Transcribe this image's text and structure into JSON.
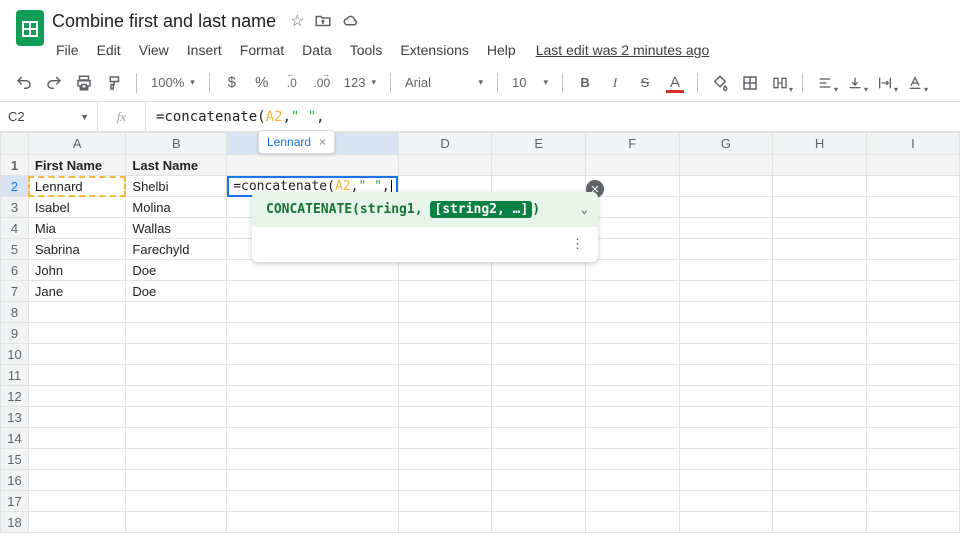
{
  "header": {
    "doc_title": "Combine first and last name",
    "menus": [
      "File",
      "Edit",
      "View",
      "Insert",
      "Format",
      "Data",
      "Tools",
      "Extensions",
      "Help"
    ],
    "last_edit": "Last edit was 2 minutes ago"
  },
  "toolbar": {
    "zoom": "100%",
    "currency_format": "$",
    "percent_format": "%",
    "dec_decrease": ".0",
    "dec_increase": ".00",
    "number_format": "123",
    "font": "Arial",
    "font_size": "10",
    "bold": "B",
    "italic": "I",
    "strike": "S",
    "text_color": "A"
  },
  "formula_bar": {
    "cell_ref": "C2",
    "fx": "fx",
    "formula_plain": "=concatenate(A2,\" \",",
    "tokens": {
      "fn": "=concatenate(",
      "ref": "A2",
      "sep1": ",",
      "str": "\" \"",
      "sep2": ","
    }
  },
  "grid": {
    "columns": [
      "A",
      "B",
      "C",
      "D",
      "E",
      "F",
      "G",
      "H",
      "I"
    ],
    "row_count": 18,
    "header_row": [
      "First Name",
      "Last Name",
      "",
      "",
      "",
      "",
      "",
      "",
      ""
    ],
    "rows": [
      [
        "Lennard",
        "Shelbi",
        "",
        "",
        "",
        "",
        "",
        "",
        ""
      ],
      [
        "Isabel",
        "Molina",
        "",
        "",
        "",
        "",
        "",
        "",
        ""
      ],
      [
        "Mia",
        "Wallas",
        "",
        "",
        "",
        "",
        "",
        "",
        ""
      ],
      [
        "Sabrina",
        "Farechyld",
        "",
        "",
        "",
        "",
        "",
        "",
        ""
      ],
      [
        "John",
        "Doe",
        "",
        "",
        "",
        "",
        "",
        "",
        ""
      ],
      [
        "Jane",
        "Doe",
        "",
        "",
        "",
        "",
        "",
        "",
        ""
      ]
    ],
    "active_cell": "C2",
    "referenced_cell": "A2",
    "editing_tokens": {
      "fn": "=concatenate(",
      "ref": "A2",
      "sep1": ",",
      "str": "\" \"",
      "sep2": ","
    }
  },
  "preview": {
    "value": "Lennard",
    "close": "×"
  },
  "hint": {
    "fn": "CONCATENATE",
    "args": "(string1, ",
    "active_arg": "[string2, …]",
    "tail": ")",
    "chevron": "⌄",
    "more": "⋮",
    "close": "✕"
  }
}
